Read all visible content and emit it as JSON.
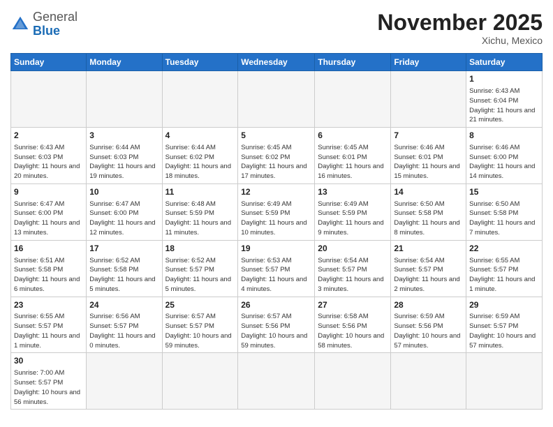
{
  "header": {
    "logo_general": "General",
    "logo_blue": "Blue",
    "month_title": "November 2025",
    "location": "Xichu, Mexico"
  },
  "weekdays": [
    "Sunday",
    "Monday",
    "Tuesday",
    "Wednesday",
    "Thursday",
    "Friday",
    "Saturday"
  ],
  "days": {
    "1": {
      "sunrise": "6:43 AM",
      "sunset": "6:04 PM",
      "daylight": "11 hours and 21 minutes."
    },
    "2": {
      "sunrise": "6:43 AM",
      "sunset": "6:03 PM",
      "daylight": "11 hours and 20 minutes."
    },
    "3": {
      "sunrise": "6:44 AM",
      "sunset": "6:03 PM",
      "daylight": "11 hours and 19 minutes."
    },
    "4": {
      "sunrise": "6:44 AM",
      "sunset": "6:02 PM",
      "daylight": "11 hours and 18 minutes."
    },
    "5": {
      "sunrise": "6:45 AM",
      "sunset": "6:02 PM",
      "daylight": "11 hours and 17 minutes."
    },
    "6": {
      "sunrise": "6:45 AM",
      "sunset": "6:01 PM",
      "daylight": "11 hours and 16 minutes."
    },
    "7": {
      "sunrise": "6:46 AM",
      "sunset": "6:01 PM",
      "daylight": "11 hours and 15 minutes."
    },
    "8": {
      "sunrise": "6:46 AM",
      "sunset": "6:00 PM",
      "daylight": "11 hours and 14 minutes."
    },
    "9": {
      "sunrise": "6:47 AM",
      "sunset": "6:00 PM",
      "daylight": "11 hours and 13 minutes."
    },
    "10": {
      "sunrise": "6:47 AM",
      "sunset": "6:00 PM",
      "daylight": "11 hours and 12 minutes."
    },
    "11": {
      "sunrise": "6:48 AM",
      "sunset": "5:59 PM",
      "daylight": "11 hours and 11 minutes."
    },
    "12": {
      "sunrise": "6:49 AM",
      "sunset": "5:59 PM",
      "daylight": "11 hours and 10 minutes."
    },
    "13": {
      "sunrise": "6:49 AM",
      "sunset": "5:59 PM",
      "daylight": "11 hours and 9 minutes."
    },
    "14": {
      "sunrise": "6:50 AM",
      "sunset": "5:58 PM",
      "daylight": "11 hours and 8 minutes."
    },
    "15": {
      "sunrise": "6:50 AM",
      "sunset": "5:58 PM",
      "daylight": "11 hours and 7 minutes."
    },
    "16": {
      "sunrise": "6:51 AM",
      "sunset": "5:58 PM",
      "daylight": "11 hours and 6 minutes."
    },
    "17": {
      "sunrise": "6:52 AM",
      "sunset": "5:58 PM",
      "daylight": "11 hours and 5 minutes."
    },
    "18": {
      "sunrise": "6:52 AM",
      "sunset": "5:57 PM",
      "daylight": "11 hours and 5 minutes."
    },
    "19": {
      "sunrise": "6:53 AM",
      "sunset": "5:57 PM",
      "daylight": "11 hours and 4 minutes."
    },
    "20": {
      "sunrise": "6:54 AM",
      "sunset": "5:57 PM",
      "daylight": "11 hours and 3 minutes."
    },
    "21": {
      "sunrise": "6:54 AM",
      "sunset": "5:57 PM",
      "daylight": "11 hours and 2 minutes."
    },
    "22": {
      "sunrise": "6:55 AM",
      "sunset": "5:57 PM",
      "daylight": "11 hours and 1 minute."
    },
    "23": {
      "sunrise": "6:55 AM",
      "sunset": "5:57 PM",
      "daylight": "11 hours and 1 minute."
    },
    "24": {
      "sunrise": "6:56 AM",
      "sunset": "5:57 PM",
      "daylight": "11 hours and 0 minutes."
    },
    "25": {
      "sunrise": "6:57 AM",
      "sunset": "5:57 PM",
      "daylight": "10 hours and 59 minutes."
    },
    "26": {
      "sunrise": "6:57 AM",
      "sunset": "5:56 PM",
      "daylight": "10 hours and 59 minutes."
    },
    "27": {
      "sunrise": "6:58 AM",
      "sunset": "5:56 PM",
      "daylight": "10 hours and 58 minutes."
    },
    "28": {
      "sunrise": "6:59 AM",
      "sunset": "5:56 PM",
      "daylight": "10 hours and 57 minutes."
    },
    "29": {
      "sunrise": "6:59 AM",
      "sunset": "5:57 PM",
      "daylight": "10 hours and 57 minutes."
    },
    "30": {
      "sunrise": "7:00 AM",
      "sunset": "5:57 PM",
      "daylight": "10 hours and 56 minutes."
    }
  }
}
